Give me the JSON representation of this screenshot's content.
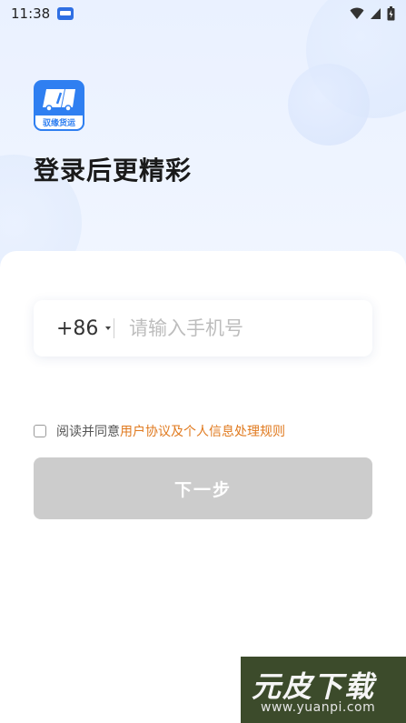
{
  "status_bar": {
    "time": "11:38"
  },
  "logo": {
    "label": "驭缘货运"
  },
  "page_title": "登录后更精彩",
  "phone_form": {
    "country_code": "+86",
    "phone_placeholder": "请输入手机号",
    "phone_value": ""
  },
  "agreement": {
    "prefix": "阅读并同意",
    "link": "用户协议及个人信息处理规则",
    "checked": false
  },
  "next_button": {
    "label": "下一步",
    "enabled": false,
    "color": "#cccccc"
  },
  "watermark": {
    "title": "元皮下载",
    "url": "www.yuanpi.com"
  },
  "colors": {
    "brand": "#2f7ff1",
    "link": "#e07a1f"
  }
}
